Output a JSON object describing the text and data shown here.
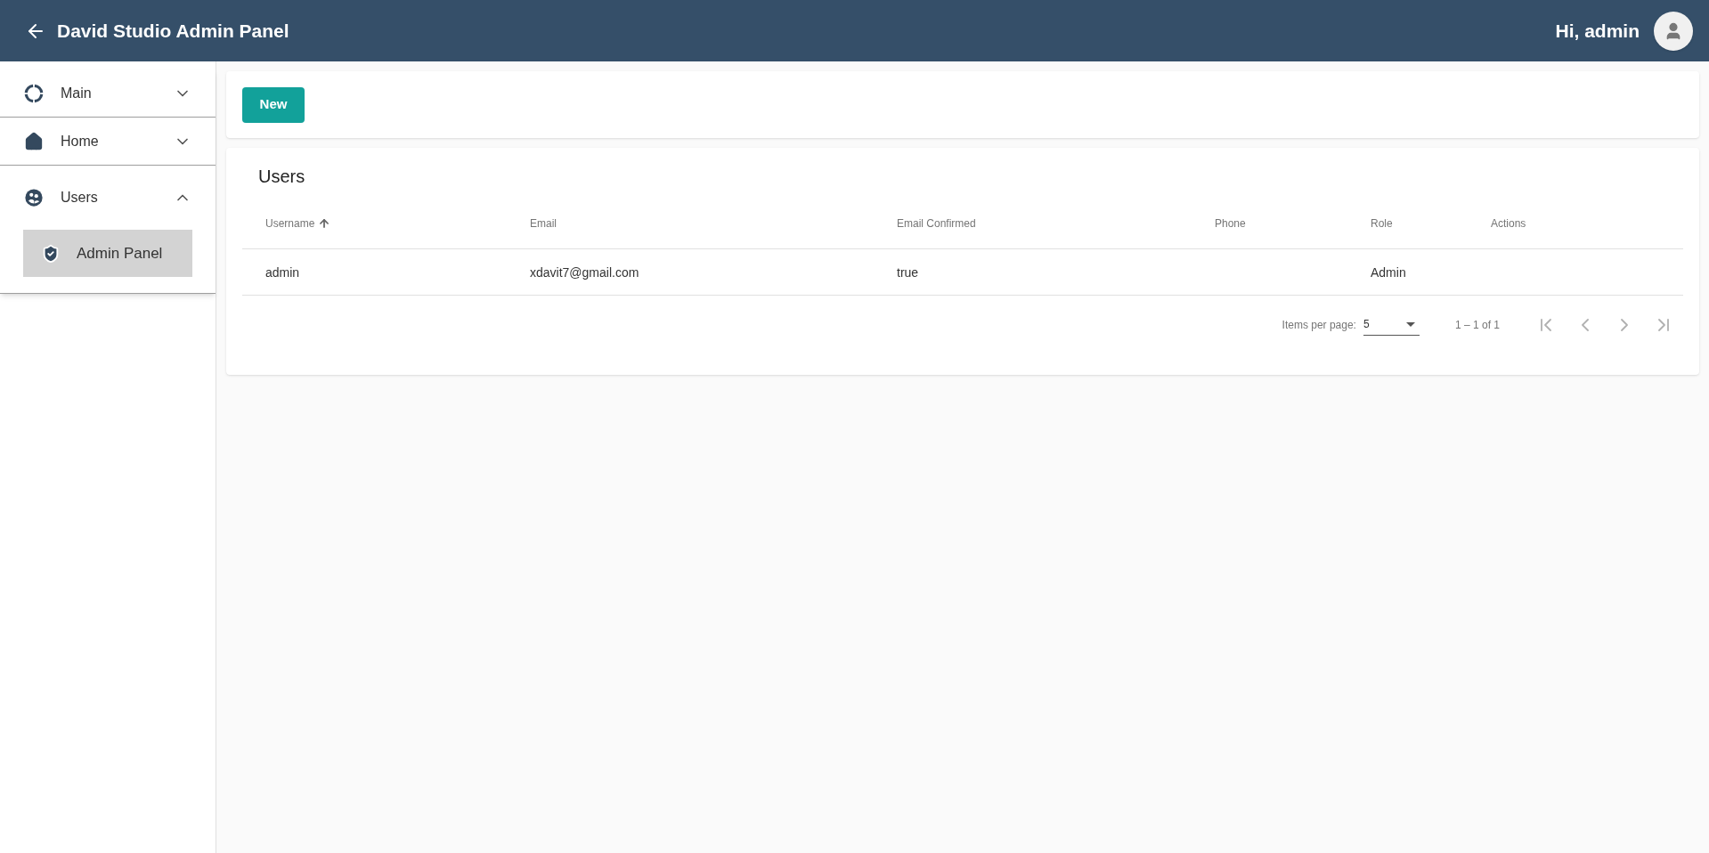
{
  "header": {
    "title": "David Studio Admin Panel",
    "greeting": "Hi, admin"
  },
  "sidebar": {
    "items": [
      {
        "label": "Main",
        "expanded": false
      },
      {
        "label": "Home",
        "expanded": false
      },
      {
        "label": "Users",
        "expanded": true,
        "children": [
          {
            "label": "Admin Panel",
            "selected": true
          }
        ]
      }
    ]
  },
  "toolbar": {
    "new_button": "New"
  },
  "table": {
    "title": "Users",
    "columns": [
      {
        "label": "Username",
        "sorted": true
      },
      {
        "label": "Email",
        "sorted": false
      },
      {
        "label": "Email Confirmed",
        "sorted": false
      },
      {
        "label": "Phone",
        "sorted": false
      },
      {
        "label": "Role",
        "sorted": false
      },
      {
        "label": "Actions",
        "sorted": false
      }
    ],
    "rows": [
      [
        "admin",
        "xdavit7@gmail.com",
        "true",
        "",
        "Admin",
        ""
      ]
    ]
  },
  "paginator": {
    "items_per_page_label": "Items per page:",
    "page_size": "5",
    "range": "1 – 1 of 1",
    "buttons": [
      {
        "kind": "first",
        "disabled": true
      },
      {
        "kind": "previous",
        "disabled": true
      },
      {
        "kind": "next",
        "disabled": true
      },
      {
        "kind": "last",
        "disabled": true
      }
    ]
  }
}
